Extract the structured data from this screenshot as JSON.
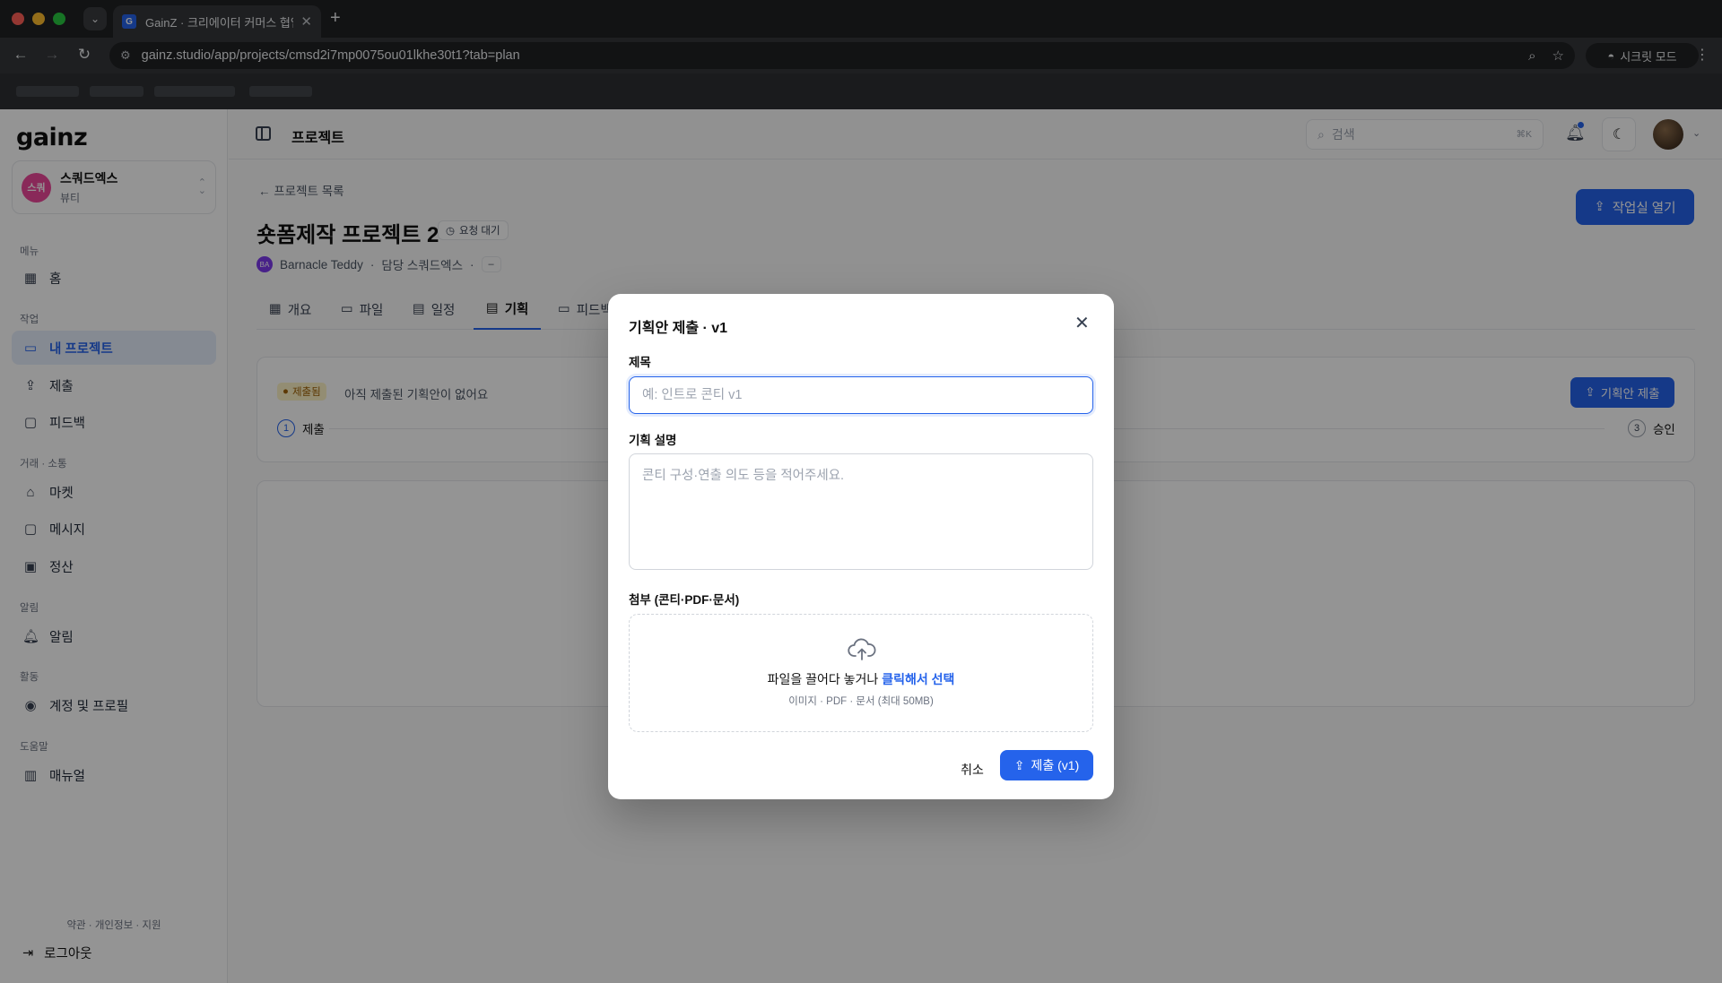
{
  "browser": {
    "tab_title": "GainZ · 크리에이터 커머스 협업 C",
    "tab_favicon": "G",
    "url": "gainz.studio/app/projects/cmsd2i7mp0075ou01lkhe30t1?tab=plan",
    "incognito_label": "시크릿 모드"
  },
  "sidebar": {
    "logo": "gainz",
    "workspace": {
      "avatar": "스쿼",
      "name": "스쿼드엑스",
      "category": "뷰티"
    },
    "sections": {
      "menu": "메뉴",
      "work": "작업",
      "trade": "거래 · 소통",
      "alerts": "알림",
      "activity": "활동",
      "help": "도움말"
    },
    "items": {
      "home": "홈",
      "my_projects": "내 프로젝트",
      "submissions": "제출",
      "feedback": "피드백",
      "market": "마켓",
      "messages": "메시지",
      "settlement": "정산",
      "notifications": "알림",
      "account": "계정 및 프로필",
      "manual": "매뉴얼"
    },
    "legal": "약관 · 개인정보 · 지원",
    "logout": "로그아웃"
  },
  "topbar": {
    "title": "프로젝트",
    "search_placeholder": "검색",
    "search_shortcut": "⌘K"
  },
  "project": {
    "back_label": "프로젝트 목록",
    "title": "숏폼제작 프로젝트 2",
    "status": "요청 대기",
    "owner_initials": "BA",
    "owner": "Barnacle Teddy",
    "manager": "담당 스쿼드엑스",
    "open_studio_label": "작업실 열기",
    "tabs": {
      "overview": "개요",
      "files": "파일",
      "schedule": "일정",
      "plan": "기획",
      "feedback": "피드백"
    },
    "plan_card": {
      "badge": "제출됨",
      "empty_text": "아직 제출된 기획안이 없어요",
      "submit_label": "기획안 제출",
      "step1_num": "1",
      "step1_label": "제출",
      "step3_num": "3",
      "step3_label": "승인"
    }
  },
  "modal": {
    "title": "기획안 제출 · v1",
    "title_label": "제목",
    "title_placeholder": "예: 인트로 콘티 v1",
    "desc_label": "기획 설명",
    "desc_placeholder": "콘티 구성·연출 의도 등을 적어주세요.",
    "attach_label": "첨부 (콘티·PDF·문서)",
    "drop_text": "파일을 끌어다 놓거나",
    "drop_link": "클릭해서 선택",
    "drop_hint": "이미지 · PDF · 문서 (최대 50MB)",
    "cancel_label": "취소",
    "submit_label": "제출 (v1)"
  },
  "colors": {
    "accent": "#2563eb",
    "active_nav_bg": "#e6eefc",
    "workspace_avatar": "#ec4899",
    "badge_bg": "#fef3c7"
  }
}
